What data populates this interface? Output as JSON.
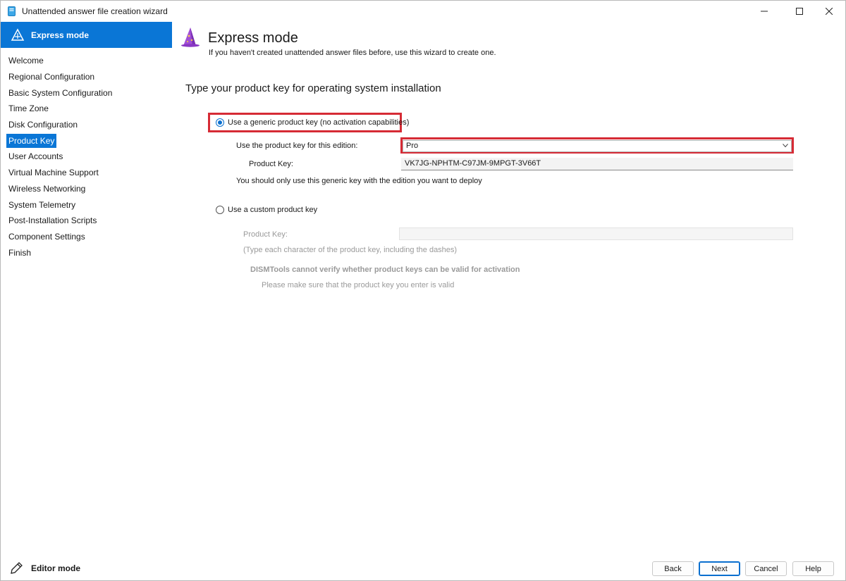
{
  "window": {
    "title": "Unattended answer file creation wizard"
  },
  "sidebar": {
    "header": "Express mode",
    "items": [
      {
        "label": "Welcome"
      },
      {
        "label": "Regional Configuration"
      },
      {
        "label": "Basic System Configuration"
      },
      {
        "label": "Time Zone"
      },
      {
        "label": "Disk Configuration"
      },
      {
        "label": "Product Key"
      },
      {
        "label": "User Accounts"
      },
      {
        "label": "Virtual Machine Support"
      },
      {
        "label": "Wireless Networking"
      },
      {
        "label": "System Telemetry"
      },
      {
        "label": "Post-Installation Scripts"
      },
      {
        "label": "Component Settings"
      },
      {
        "label": "Finish"
      }
    ],
    "active_item": "Product Key",
    "footer": "Editor mode"
  },
  "main": {
    "title": "Express mode",
    "subtitle": "If you haven't created unattended answer files before, use this wizard to create one.",
    "section_title": "Type your product key for operating system installation",
    "generic": {
      "radio_label": "Use a generic product key (no activation capabilities)",
      "checked": true,
      "edition_label": "Use the product key for this edition:",
      "edition_value": "Pro",
      "product_key_label": "Product Key:",
      "product_key_value": "VK7JG-NPHTM-C97JM-9MPGT-3V66T",
      "note": "You should only use this generic key with the edition you want to deploy"
    },
    "custom": {
      "radio_label": "Use a custom product key",
      "checked": false,
      "product_key_label": "Product Key:",
      "product_key_value": "",
      "hint": "(Type each character of the product key, including the dashes)",
      "warning_title": "DISMTools cannot verify whether product keys can be valid for activation",
      "warning_text": "Please make sure that the product key you enter is valid"
    }
  },
  "buttons": {
    "back": "Back",
    "next": "Next",
    "cancel": "Cancel",
    "help": "Help"
  },
  "colors": {
    "accent": "#0a76d6",
    "highlight": "#d62b35"
  }
}
